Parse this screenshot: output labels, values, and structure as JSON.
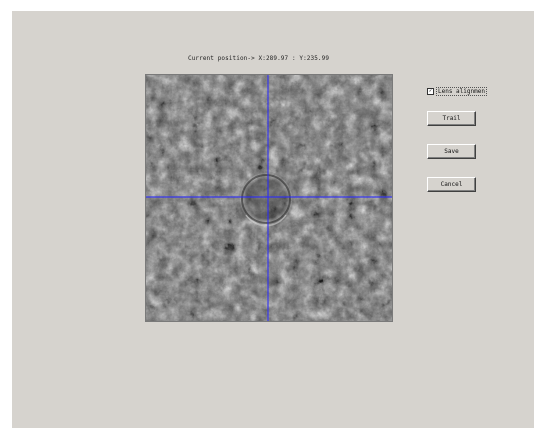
{
  "status": {
    "position_text": "Current position-> X:289.97 : Y:235.99"
  },
  "controls": {
    "lens_alignment_label": "Lens alignmen",
    "lens_alignment_checked": true,
    "trail_label": "Trail",
    "save_label": "Save",
    "cancel_label": "Cancel"
  },
  "colors": {
    "window_bg": "#d6d3ce",
    "crosshair": "#2a2aff"
  },
  "icons": {
    "checkbox_mark": "checkmark-icon"
  }
}
